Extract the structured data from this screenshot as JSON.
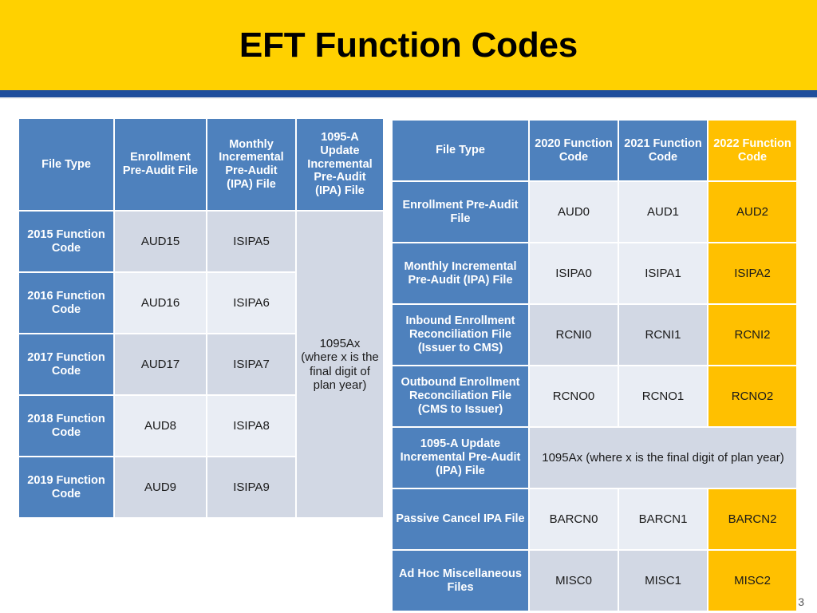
{
  "slide": {
    "title": "EFT Function Codes",
    "page_number": "3",
    "colors": {
      "banner": "#ffd100",
      "banner_rule": "#1f4e9c",
      "header_blue": "#4e81bd",
      "highlight_yellow": "#ffc000",
      "row_band_dark": "#d2d8e4",
      "row_band_light": "#e9edf4"
    }
  },
  "left_table": {
    "headers": [
      "File Type",
      "Enrollment Pre-Audit File",
      "Monthly Incremental Pre-Audit (IPA) File",
      "1095-A Update Incremental Pre-Audit (IPA) File"
    ],
    "merged_note": "1095Ax (where x is the final digit of plan year)",
    "rows": [
      {
        "label": "2015 Function Code",
        "enrollment": "AUD15",
        "monthly_ipa": "ISIPA5"
      },
      {
        "label": "2016 Function Code",
        "enrollment": "AUD16",
        "monthly_ipa": "ISIPA6"
      },
      {
        "label": "2017 Function Code",
        "enrollment": "AUD17",
        "monthly_ipa": "ISIPA7"
      },
      {
        "label": "2018 Function Code",
        "enrollment": "AUD8",
        "monthly_ipa": "ISIPA8"
      },
      {
        "label": "2019 Function Code",
        "enrollment": "AUD9",
        "monthly_ipa": "ISIPA9"
      }
    ]
  },
  "right_table": {
    "headers": [
      "File Type",
      "2020 Function Code",
      "2021 Function Code",
      "2022 Function Code"
    ],
    "merged_note": "1095Ax (where x is the final digit of plan year)",
    "rows": [
      {
        "label": "Enrollment Pre-Audit File",
        "y2020": "AUD0",
        "y2021": "AUD1",
        "y2022": "AUD2"
      },
      {
        "label": "Monthly Incremental Pre-Audit (IPA) File",
        "y2020": "ISIPA0",
        "y2021": "ISIPA1",
        "y2022": "ISIPA2"
      },
      {
        "label": "Inbound Enrollment Reconciliation File (Issuer to CMS)",
        "y2020": "RCNI0",
        "y2021": "RCNI1",
        "y2022": "RCNI2"
      },
      {
        "label": "Outbound Enrollment Reconciliation File (CMS to Issuer)",
        "y2020": "RCNO0",
        "y2021": "RCNO1",
        "y2022": "RCNO2"
      },
      {
        "label": "1095-A Update Incremental Pre-Audit (IPA) File",
        "y2020": "",
        "y2021": "",
        "y2022": ""
      },
      {
        "label": "Passive Cancel IPA File",
        "y2020": "BARCN0",
        "y2021": "BARCN1",
        "y2022": "BARCN2"
      },
      {
        "label": "Ad Hoc Miscellaneous Files",
        "y2020": "MISC0",
        "y2021": "MISC1",
        "y2022": "MISC2"
      }
    ]
  }
}
